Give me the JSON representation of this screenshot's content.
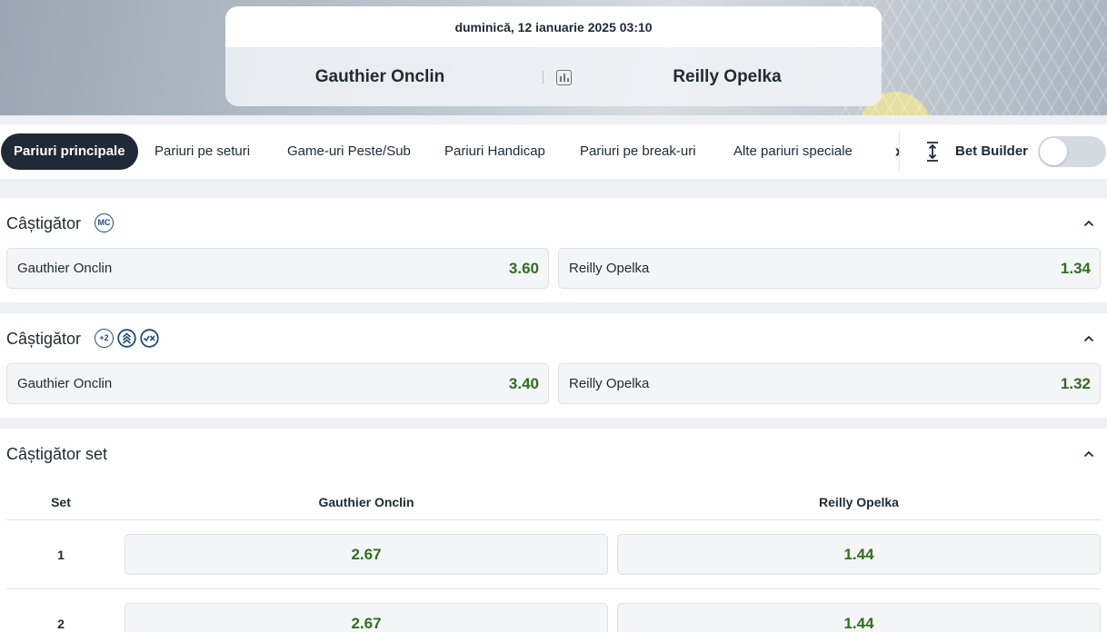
{
  "match": {
    "date": "duminică, 12 ianuarie 2025 03:10",
    "home": "Gauthier Onclin",
    "away": "Reilly Opelka",
    "stats_icon": "bar-chart-icon"
  },
  "tabs": [
    {
      "label": "Pariuri principale",
      "active": true
    },
    {
      "label": "Pariuri pe seturi"
    },
    {
      "label": "Game-uri Peste/Sub"
    },
    {
      "label": "Pariuri Handicap"
    },
    {
      "label": "Pariuri pe break-uri"
    },
    {
      "label": "Alte pariuri speciale"
    }
  ],
  "tabs_next_icon": "chevron-right-icon",
  "bet_builder": {
    "label": "Bet Builder",
    "icon": "expand-vertical-icon",
    "enabled": false
  },
  "markets": [
    {
      "title": "Câștigător",
      "badges": [
        "MC"
      ],
      "outcomes": [
        {
          "name": "Gauthier Onclin",
          "odd": "3.60"
        },
        {
          "name": "Reilly Opelka",
          "odd": "1.34"
        }
      ]
    },
    {
      "title": "Câștigător",
      "badges": [
        "+2",
        "boost-icon",
        "check-cross-icon"
      ],
      "outcomes": [
        {
          "name": "Gauthier Onclin",
          "odd": "3.40"
        },
        {
          "name": "Reilly Opelka",
          "odd": "1.32"
        }
      ]
    }
  ],
  "set_market": {
    "title": "Câștigător set",
    "headers": {
      "set": "Set",
      "home": "Gauthier Onclin",
      "away": "Reilly Opelka"
    },
    "rows": [
      {
        "set": "1",
        "home": "2.67",
        "away": "1.44"
      },
      {
        "set": "2",
        "home": "2.67",
        "away": "1.44"
      }
    ]
  },
  "colors": {
    "accent_dark": "#1e2a35",
    "odd_green": "#2f6f1e",
    "badge_blue": "#1f4a7a"
  }
}
